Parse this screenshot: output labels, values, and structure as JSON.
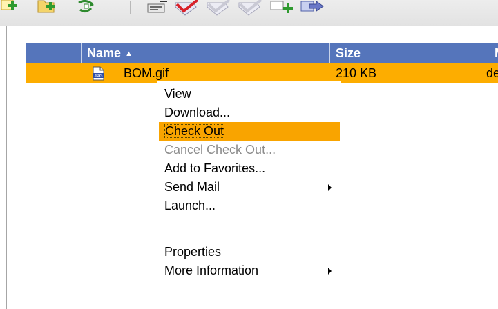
{
  "toolbar": {
    "icons": [
      "new-document-icon",
      "new-folder-icon",
      "refresh-icon",
      "edit-properties-icon",
      "check-out-icon",
      "check-in-icon",
      "cancel-check-out-icon",
      "copy-icon",
      "move-icon"
    ]
  },
  "grid": {
    "columns": [
      {
        "label": "Name",
        "sorted": "ascending"
      },
      {
        "label": "Size"
      },
      {
        "label": "M"
      }
    ],
    "rows": [
      {
        "name": "BOM.gif",
        "size": "210 KB",
        "modified": "de",
        "icon": "jpg-file-icon"
      }
    ]
  },
  "context_menu": {
    "items": [
      {
        "label": "View"
      },
      {
        "label": "Download..."
      },
      {
        "label": "Check Out",
        "highlighted": true
      },
      {
        "label": "Cancel Check Out...",
        "disabled": true
      },
      {
        "label": "Add to Favorites..."
      },
      {
        "label": "Send Mail",
        "submenu": true
      },
      {
        "label": "Launch..."
      },
      {
        "label": "Properties"
      },
      {
        "label": "More Information",
        "submenu": true
      }
    ]
  },
  "colors": {
    "header_bg": "#5575bb",
    "selection": "#fdad00",
    "menu_highlight": "#f9a400"
  }
}
